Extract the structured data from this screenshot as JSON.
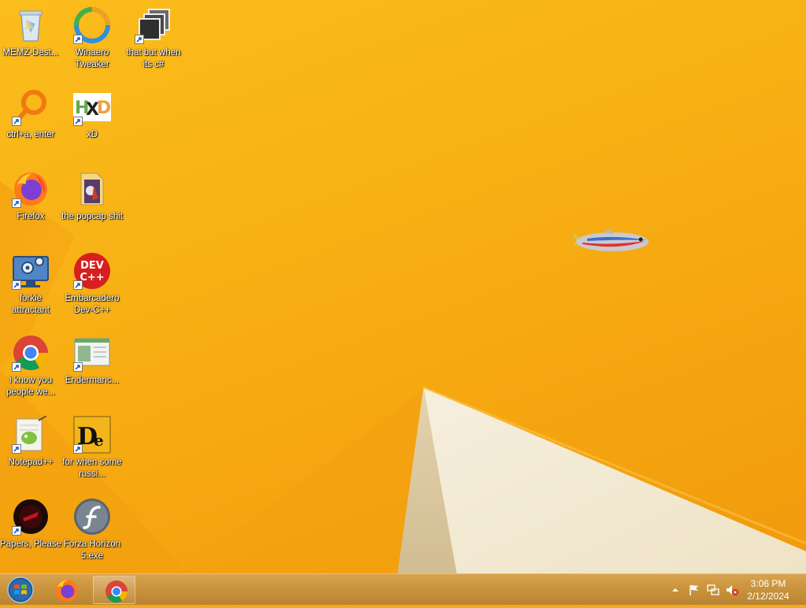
{
  "desktop": {
    "icons": [
      {
        "label": "MEMZ-Dest...",
        "icon": "recycle-bin-icon",
        "shortcut": false
      },
      {
        "label": "Winaero Tweaker",
        "icon": "winaero-tweaker-icon",
        "shortcut": true
      },
      {
        "label": "that but when its c#",
        "icon": "stacked-windows-icon",
        "shortcut": true
      },
      {
        "label": "ctrl+a, enter",
        "icon": "orange-ring-icon",
        "shortcut": true
      },
      {
        "label": "xD",
        "icon": "hxd-icon",
        "shortcut": true
      },
      {
        "label": "Firefox",
        "icon": "firefox-icon",
        "shortcut": true
      },
      {
        "label": "the popcap shit",
        "icon": "folder-icon",
        "shortcut": false
      },
      {
        "label": "forkie attractant",
        "icon": "monitor-gear-icon",
        "shortcut": true
      },
      {
        "label": "Embarcadero Dev-C++",
        "icon": "devcpp-icon",
        "shortcut": true,
        "badge_text": "DEV\nC++"
      },
      {
        "label": "i know you people we...",
        "icon": "chrome-icon",
        "shortcut": true
      },
      {
        "label": "Endermanc...",
        "icon": "window-app-icon",
        "shortcut": true
      },
      {
        "label": "Notepad++",
        "icon": "notepad-plus-plus-icon",
        "shortcut": true
      },
      {
        "label": "for when some russi...",
        "icon": "de-app-icon",
        "shortcut": true
      },
      {
        "label": "Papers, Please",
        "icon": "papers-please-icon",
        "shortcut": true
      },
      {
        "label": "Forza Horizon 5.exe",
        "icon": "flash-player-icon",
        "shortcut": false
      }
    ]
  },
  "taskbar": {
    "start_icon": "windows-orb-icon",
    "apps": [
      {
        "name": "Firefox",
        "icon": "firefox-icon",
        "active": false
      },
      {
        "name": "Chrome",
        "icon": "chrome-icon",
        "active": true
      }
    ],
    "tray": [
      "show-hidden-icons-icon",
      "action-center-flag-icon",
      "network-icon",
      "volume-muted-icon"
    ],
    "clock": {
      "time": "3:06 PM",
      "date": "2/12/2024"
    }
  },
  "colors": {
    "wallpaper_orange": "#f8b215",
    "wallpaper_cream": "#f4ecd8",
    "taskbar": "#c9923c"
  }
}
